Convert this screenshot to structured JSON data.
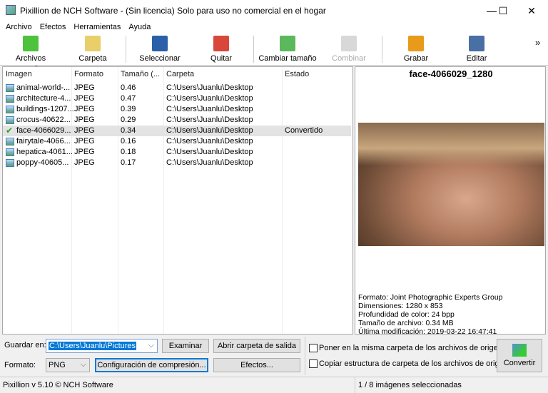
{
  "window": {
    "title": "Pixillion de NCH Software - (Sin licencia) Solo para uso no comercial en el hogar",
    "minimize": "—",
    "maximize": "☐",
    "close": "✕"
  },
  "menu": [
    "Archivo",
    "Efectos",
    "Herramientas",
    "Ayuda"
  ],
  "toolbar": {
    "items": [
      {
        "label": "Archivos",
        "icon": "plus-icon",
        "color": "#4cc33a",
        "enabled": true
      },
      {
        "label": "Carpeta",
        "icon": "folder-add-icon",
        "color": "#e8cf6a",
        "enabled": true
      },
      {
        "label": "Seleccionar",
        "icon": "checklist-icon",
        "color": "#2b5fa8",
        "enabled": true
      },
      {
        "label": "Quitar",
        "icon": "remove-icon",
        "color": "#d9463b",
        "enabled": true
      },
      {
        "label": "Cambiar tamaño",
        "icon": "resize-icon",
        "color": "#5cb85c",
        "enabled": true
      },
      {
        "label": "Combinar",
        "icon": "combine-icon",
        "color": "#d8d8d8",
        "enabled": false
      },
      {
        "label": "Grabar",
        "icon": "burn-icon",
        "color": "#e89a1a",
        "enabled": true
      },
      {
        "label": "Editar",
        "icon": "edit-icon",
        "color": "#4a6fa5",
        "enabled": true
      }
    ],
    "more": "»"
  },
  "list": {
    "columns": [
      "Imagen",
      "Formato",
      "Tamaño (...",
      "Carpeta",
      "Estado"
    ],
    "rows": [
      {
        "name": "animal-world-...",
        "format": "JPEG",
        "size": "0.46",
        "folder": "C:\\Users\\Juanlu\\Desktop",
        "status": ""
      },
      {
        "name": "architecture-4...",
        "format": "JPEG",
        "size": "0.47",
        "folder": "C:\\Users\\Juanlu\\Desktop",
        "status": ""
      },
      {
        "name": "buildings-1207...",
        "format": "JPEG",
        "size": "0.39",
        "folder": "C:\\Users\\Juanlu\\Desktop",
        "status": ""
      },
      {
        "name": "crocus-40622...",
        "format": "JPEG",
        "size": "0.29",
        "folder": "C:\\Users\\Juanlu\\Desktop",
        "status": ""
      },
      {
        "name": "face-4066029...",
        "format": "JPEG",
        "size": "0.34",
        "folder": "C:\\Users\\Juanlu\\Desktop",
        "status": "Convertido",
        "selected": true
      },
      {
        "name": "fairytale-4066...",
        "format": "JPEG",
        "size": "0.16",
        "folder": "C:\\Users\\Juanlu\\Desktop",
        "status": ""
      },
      {
        "name": "hepatica-4061...",
        "format": "JPEG",
        "size": "0.18",
        "folder": "C:\\Users\\Juanlu\\Desktop",
        "status": ""
      },
      {
        "name": "poppy-40605...",
        "format": "JPEG",
        "size": "0.17",
        "folder": "C:\\Users\\Juanlu\\Desktop",
        "status": ""
      }
    ]
  },
  "preview": {
    "title": "face-4066029_1280",
    "info": [
      "Formato: Joint Photographic Experts Group",
      "Dimensiones: 1280 x 853",
      "Profundidad de color: 24 bpp",
      "Tamaño de archivo: 0.34 MB",
      "Última modificación: 2019-03-22 16:47:41"
    ]
  },
  "bottom": {
    "save_label": "Guardar en:",
    "save_value": "C:\\Users\\Juanlu\\Pictures",
    "browse": "Examinar",
    "open_output": "Abrir carpeta de salida",
    "format_label": "Formato:",
    "format_value": "PNG",
    "compression": "Configuración de compresión...",
    "effects": "Efectos...",
    "same_folder": "Poner en la misma carpeta de los archivos de origen",
    "copy_structure": "Copiar estructura de carpeta de los archivos de origen",
    "convert": "Convertir"
  },
  "status": {
    "left": "Pixillion v 5.10 © NCH Software",
    "right": "1 / 8 imágenes seleccionadas"
  }
}
